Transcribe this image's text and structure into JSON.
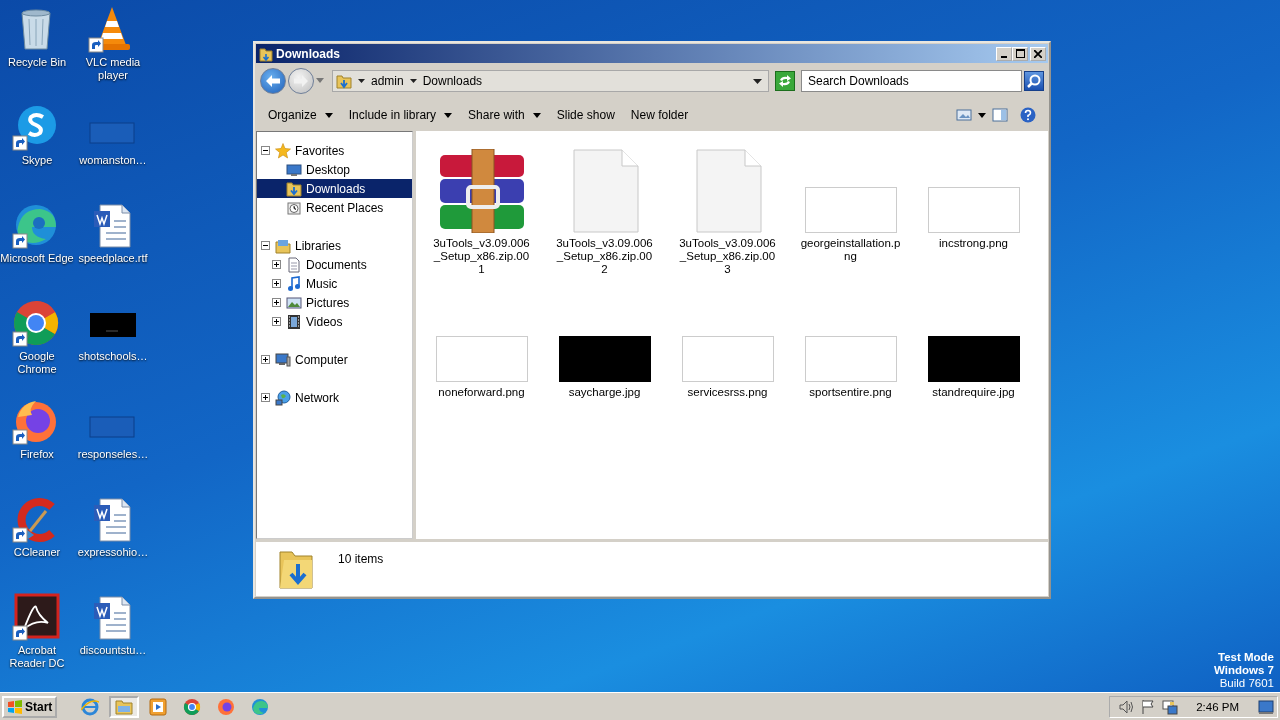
{
  "desktop": {
    "icons": [
      {
        "label": "Recycle Bin",
        "kind": "bin",
        "shortcut": false
      },
      {
        "label": "VLC media player",
        "kind": "cone",
        "shortcut": true
      },
      {
        "label": "Skype",
        "kind": "skype",
        "shortcut": true
      },
      {
        "label": "womanston…",
        "kind": "blank",
        "shortcut": false
      },
      {
        "label": "Microsoft Edge",
        "kind": "edge",
        "shortcut": true
      },
      {
        "label": "speedplace.rtf",
        "kind": "word",
        "shortcut": false
      },
      {
        "label": "Google Chrome",
        "kind": "chrome",
        "shortcut": true
      },
      {
        "label": "shotschools…",
        "kind": "dark",
        "shortcut": false
      },
      {
        "label": "Firefox",
        "kind": "firefox",
        "shortcut": true
      },
      {
        "label": "responseles…",
        "kind": "blank",
        "shortcut": false
      },
      {
        "label": "CCleaner",
        "kind": "ccleaner",
        "shortcut": true
      },
      {
        "label": "expressohio…",
        "kind": "word",
        "shortcut": false
      },
      {
        "label": "Acrobat Reader DC",
        "kind": "acrobat",
        "shortcut": true
      },
      {
        "label": "discountstu…",
        "kind": "word",
        "shortcut": false
      }
    ],
    "notice": [
      {
        "text": "Test Mode",
        "bold": true
      },
      {
        "text": "Windows 7",
        "bold": true
      },
      {
        "text": "Build 7601",
        "bold": false
      }
    ]
  },
  "explorer": {
    "title": "Downloads",
    "breadcrumb": [
      "admin",
      "Downloads"
    ],
    "search": {
      "placeholder": "Search Downloads"
    },
    "commands": [
      {
        "label": "Organize",
        "dropdown": true
      },
      {
        "label": "Include in library",
        "dropdown": true
      },
      {
        "label": "Share with",
        "dropdown": true
      },
      {
        "label": "Slide show",
        "dropdown": false
      },
      {
        "label": "New folder",
        "dropdown": false
      }
    ],
    "tree": [
      {
        "label": "Favorites",
        "kind": "star",
        "expanded": true,
        "selected": false,
        "children": [
          {
            "label": "Desktop",
            "kind": "desktop",
            "selected": false
          },
          {
            "label": "Downloads",
            "kind": "downloads",
            "selected": true
          },
          {
            "label": "Recent Places",
            "kind": "recent",
            "selected": false
          }
        ]
      },
      {
        "label": "Libraries",
        "kind": "library",
        "expanded": true,
        "selected": false,
        "children": [
          {
            "label": "Documents",
            "kind": "documents",
            "expanded": false,
            "selected": false
          },
          {
            "label": "Music",
            "kind": "music",
            "expanded": false,
            "selected": false
          },
          {
            "label": "Pictures",
            "kind": "pictures",
            "expanded": false,
            "selected": false
          },
          {
            "label": "Videos",
            "kind": "videos",
            "expanded": false,
            "selected": false
          }
        ]
      },
      {
        "label": "Computer",
        "kind": "computer",
        "expanded": false,
        "selected": false
      },
      {
        "label": "Network",
        "kind": "network",
        "expanded": false,
        "selected": false
      }
    ],
    "files": [
      {
        "name": "3uTools_v3.09.006_Setup_x86.zip.001",
        "kind": "archive"
      },
      {
        "name": "3uTools_v3.09.006_Setup_x86.zip.002",
        "kind": "page"
      },
      {
        "name": "3uTools_v3.09.006_Setup_x86.zip.003",
        "kind": "page"
      },
      {
        "name": "georgeinstallation.png",
        "kind": "light"
      },
      {
        "name": "incstrong.png",
        "kind": "light"
      },
      {
        "name": "noneforward.png",
        "kind": "light"
      },
      {
        "name": "saycharge.jpg",
        "kind": "dark"
      },
      {
        "name": "servicesrss.png",
        "kind": "light"
      },
      {
        "name": "sportsentire.png",
        "kind": "light"
      },
      {
        "name": "standrequire.jpg",
        "kind": "dark"
      }
    ],
    "status": "10 items"
  },
  "taskbar": {
    "start": "Start",
    "apps": [
      {
        "kind": "ie",
        "selected": false
      },
      {
        "kind": "folder",
        "selected": true
      },
      {
        "kind": "player",
        "selected": false
      },
      {
        "kind": "chrome",
        "selected": false
      },
      {
        "kind": "firefox",
        "selected": false
      },
      {
        "kind": "edge",
        "selected": false
      }
    ],
    "clock": "2:46 PM"
  }
}
